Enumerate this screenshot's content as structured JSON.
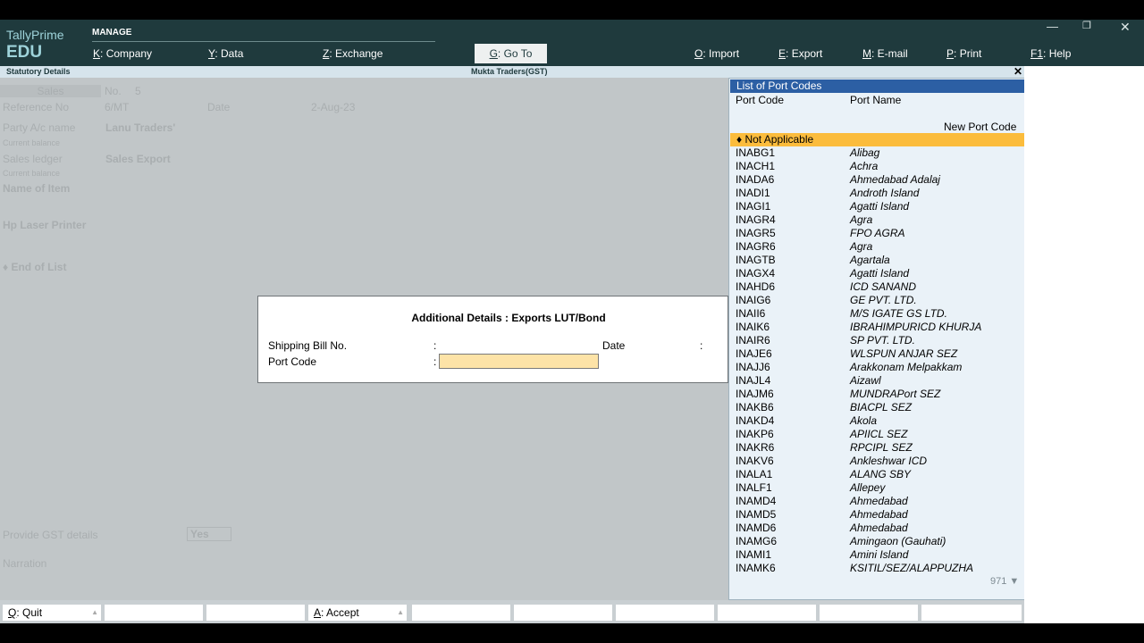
{
  "brand": {
    "line1": "TallyPrime",
    "line2": "EDU"
  },
  "menu": {
    "manage_label": "MANAGE",
    "company": {
      "key": "K",
      "label": "Company"
    },
    "data": {
      "key": "Y",
      "label": "Data"
    },
    "exchange": {
      "key": "Z",
      "label": "Exchange"
    },
    "goto": {
      "key": "G",
      "label": "Go To"
    },
    "import": {
      "key": "O",
      "label": "Import"
    },
    "export": {
      "key": "E",
      "label": "Export"
    },
    "email": {
      "key": "M",
      "label": "E-mail"
    },
    "print": {
      "key": "P",
      "label": "Print"
    },
    "help": {
      "key": "F1",
      "label": "Help"
    }
  },
  "titlebar": {
    "left": "Statutory Details",
    "center": "Mukta Traders(GST)"
  },
  "background_form": {
    "sales": "Sales",
    "no_label": "No.",
    "no_value": "5",
    "reference_label": "Reference No",
    "reference_value": "6/MT",
    "date_label": "Date",
    "date_value": "2-Aug-23",
    "party_label": "Party A/c name",
    "party_value": "Lanu Traders'",
    "current_balance": "Current balance",
    "sales_ledger_label": "Sales ledger",
    "sales_ledger_value": "Sales Export",
    "current_balance2": "Current balance",
    "name_of_item": "Name of Item",
    "item1": "Hp Laser Printer",
    "end_of_list": "♦ End of List",
    "gst_label": "Provide GST details",
    "gst_value": "Yes",
    "narration": "Narration"
  },
  "dialog": {
    "title": "Additional Details : Exports LUT/Bond",
    "shipping_bill_label": "Shipping Bill No.",
    "date_label": "Date",
    "port_code_label": "Port Code",
    "colon": ":"
  },
  "port_list": {
    "header": "List of Port Codes",
    "col_code": "Port Code",
    "col_name": "Port Name",
    "new_port_code": "New Port Code",
    "selected": "♦ Not Applicable",
    "rows": [
      {
        "code": "INABG1",
        "name": "Alibag"
      },
      {
        "code": "INACH1",
        "name": "Achra"
      },
      {
        "code": "INADA6",
        "name": "Ahmedabad Adalaj"
      },
      {
        "code": "INADI1",
        "name": "Androth Island"
      },
      {
        "code": "INAGI1",
        "name": "Agatti Island"
      },
      {
        "code": "INAGR4",
        "name": "Agra"
      },
      {
        "code": "INAGR5",
        "name": "FPO AGRA"
      },
      {
        "code": "INAGR6",
        "name": "Agra"
      },
      {
        "code": "INAGTB",
        "name": "Agartala"
      },
      {
        "code": "INAGX4",
        "name": "Agatti Island"
      },
      {
        "code": "INAHD6",
        "name": "ICD SANAND"
      },
      {
        "code": "INAIG6",
        "name": "GE PVT. LTD."
      },
      {
        "code": "INAII6",
        "name": "M/S IGATE GS LTD."
      },
      {
        "code": "INAIK6",
        "name": "IBRAHIMPURICD KHURJA"
      },
      {
        "code": "INAIR6",
        "name": "SP PVT. LTD."
      },
      {
        "code": "INAJE6",
        "name": "WLSPUN ANJAR SEZ"
      },
      {
        "code": "INAJJ6",
        "name": "Arakkonam Melpakkam"
      },
      {
        "code": "INAJL4",
        "name": "Aizawl"
      },
      {
        "code": "INAJM6",
        "name": "MUNDRAPort SEZ"
      },
      {
        "code": "INAKB6",
        "name": "BIACPL SEZ"
      },
      {
        "code": "INAKD4",
        "name": "Akola"
      },
      {
        "code": "INAKP6",
        "name": "APIICL SEZ"
      },
      {
        "code": "INAKR6",
        "name": "RPCIPL SEZ"
      },
      {
        "code": "INAKV6",
        "name": "Ankleshwar ICD"
      },
      {
        "code": "INALA1",
        "name": "ALANG SBY"
      },
      {
        "code": "INALF1",
        "name": "Allepey"
      },
      {
        "code": "INAMD4",
        "name": "Ahmedabad"
      },
      {
        "code": "INAMD5",
        "name": "Ahmedabad"
      },
      {
        "code": "INAMD6",
        "name": "Ahmedabad"
      },
      {
        "code": "INAMG6",
        "name": "Amingaon (Gauhati)"
      },
      {
        "code": "INAMI1",
        "name": "Amini Island"
      },
      {
        "code": "INAMK6",
        "name": "KSITIL/SEZ/ALAPPUZHA"
      }
    ],
    "count": "971 ▼"
  },
  "footer": {
    "quit": {
      "key": "Q",
      "label": "Quit"
    },
    "accept": {
      "key": "A",
      "label": "Accept"
    }
  }
}
